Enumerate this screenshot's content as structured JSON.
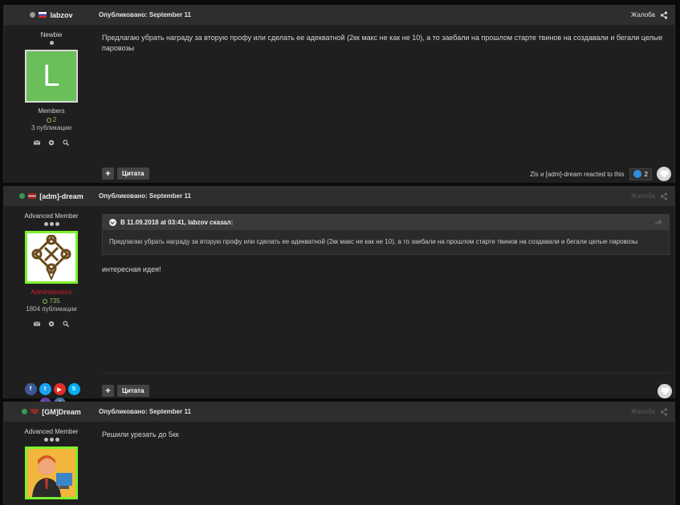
{
  "posts": [
    {
      "author": "labzov",
      "posted": "Опубликовано: September 11",
      "report": "Жалоба",
      "rank": "Newbie",
      "avatar_letter": "L",
      "group": "Members",
      "rep": "2",
      "post_count": "3 публикации",
      "text": "Предлагаю убрать награду за вторую профу или сделать ее адекватной (2кк макс не как не 10), а то заебали на прошлом старте твинов на создавали и бегали целые паровозы",
      "reactions_text": "Zls и [adm]-dream reacted to this",
      "reaction_count": "2"
    },
    {
      "author": "[adm]-dream",
      "posted": "Опубликовано: September 11",
      "report": "Жалоба",
      "rank": "Advanced Member",
      "group": "Administrators",
      "rep": "735",
      "post_count": "1804 публикации",
      "quote_header": "В 11.09.2018 at 03:41, labzov сказал:",
      "quote_text": "Предлагаю убрать награду за вторую профу или сделать ее адекватной (2кк макс не как не 10), а то заебали на прошлом старте твинов на создавали и бегали целые паровозы",
      "text": "интересная идея!",
      "edit_mark": "✕ ▾",
      "social": [
        "f",
        "t",
        "▶",
        "S",
        "tw",
        "vk"
      ]
    },
    {
      "author": "[GM]Dream",
      "posted": "Опубликовано: September 11",
      "report": "Жалоба",
      "rank": "Advanced Member",
      "text": "Решили урезать до 5кк"
    }
  ],
  "buttons": {
    "plus": "+",
    "quote": "Цитата"
  },
  "colors": {
    "accent_green": "#7cf02c",
    "admin_red": "#d0202a",
    "rep_green": "#8fc35e"
  }
}
